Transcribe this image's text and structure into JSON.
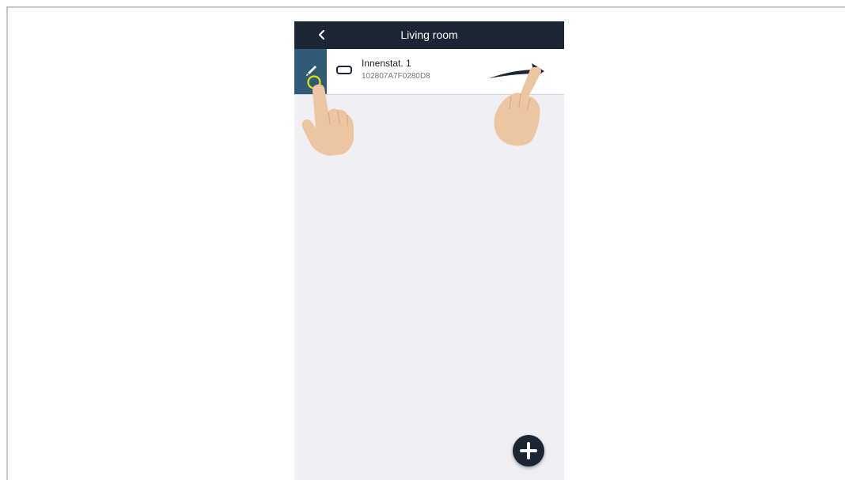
{
  "navbar": {
    "title": "Living room",
    "back_icon": "chevron-left-icon"
  },
  "device_row": {
    "name": "Innenstat. 1",
    "id": "102807A7F0280D8",
    "icon": "thermostat-icon",
    "edit_icon": "pencil-icon"
  },
  "gestures": {
    "tap_hint": "tap-edit-gesture",
    "swipe_hint": "swipe-right-gesture"
  },
  "fab": {
    "icon": "plus-icon"
  },
  "colors": {
    "navbar_bg": "#1c2533",
    "edit_tab_bg": "#2f5a78",
    "list_bg": "#f0eff4",
    "highlight_ring": "#e8e200",
    "skin": "#ecc6a2"
  }
}
